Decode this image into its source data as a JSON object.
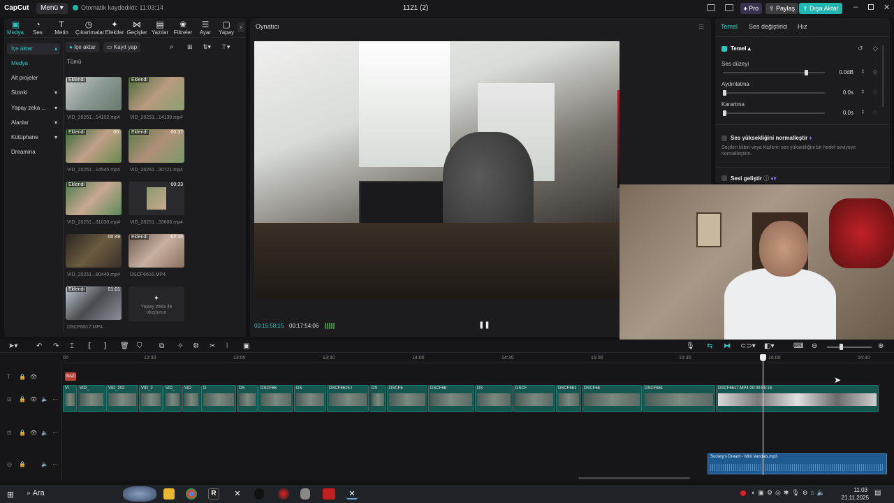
{
  "titlebar": {
    "logo": "CapCut",
    "menu": "Menü",
    "autosave": "Otomatik kaydedildi: 11:03:14",
    "project": "1121 (2)",
    "pro": "Pro",
    "share": "Paylaş",
    "upgrade": "Dışa Aktar"
  },
  "toolbar": {
    "tools": [
      {
        "label": "Medya",
        "icon": "media-icon"
      },
      {
        "label": "Ses",
        "icon": "audio-icon"
      },
      {
        "label": "Metin",
        "icon": "text-icon"
      },
      {
        "label": "Çıkartmalar",
        "icon": "sticker-icon"
      },
      {
        "label": "Efektler",
        "icon": "effects-icon"
      },
      {
        "label": "Geçişler",
        "icon": "transitions-icon"
      },
      {
        "label": "Yazılar",
        "icon": "captions-icon"
      },
      {
        "label": "Filtreler",
        "icon": "filters-icon"
      },
      {
        "label": "Ayar",
        "icon": "adjust-icon"
      },
      {
        "label": "Yapay",
        "icon": "ai-icon"
      }
    ]
  },
  "media_nav": {
    "items": [
      {
        "label": "İçe aktar"
      },
      {
        "label": "Medya"
      },
      {
        "label": "Alt projeler"
      },
      {
        "label": "Sizinki"
      },
      {
        "label": "Yapay zeka ..."
      },
      {
        "label": "Alanlar"
      },
      {
        "label": "Kütüphane"
      },
      {
        "label": "Dreamina"
      }
    ]
  },
  "media": {
    "import_btn": "İçe aktar",
    "record_btn": "Kayıt yap",
    "filter_label": "Tümü",
    "ai_create": "Yapay zeka ile oluşturun",
    "items": [
      {
        "name": "VID_20251...14102.mp4",
        "tag": "Eklendi",
        "dur": ""
      },
      {
        "name": "VID_20251...14139.mp4",
        "tag": "Eklendi",
        "dur": ""
      },
      {
        "name": "VID_20251...14545.mp4",
        "tag": "Eklendi",
        "dur": "00:"
      },
      {
        "name": "VID_20251...30721.mp4",
        "tag": "Eklendi",
        "dur": "00:37"
      },
      {
        "name": "VID_20251...31030.mp4",
        "tag": "Eklendi",
        "dur": ""
      },
      {
        "name": "VID_20251...33606.mp4",
        "tag": "",
        "dur": "00:33"
      },
      {
        "name": "VID_20251...80449.mp4",
        "tag": "",
        "dur": "00:49"
      },
      {
        "name": "DSCF6616.MP4",
        "tag": "Eklendi",
        "dur": "02:16"
      },
      {
        "name": "DSCF6617.MP4",
        "tag": "Eklendi",
        "dur": "01:01"
      }
    ]
  },
  "player": {
    "title": "Oynatıcı",
    "current_time": "00:15:58:15",
    "total_time": "00:17:54:06"
  },
  "inspector": {
    "tabs": [
      "Temel",
      "Ses değiştirici",
      "Hız"
    ],
    "section": "Temel",
    "rows": [
      {
        "label": "Ses düzeyi",
        "value": "0.0dB",
        "level": 0.8
      },
      {
        "label": "Aydınlatma",
        "value": "0.0s",
        "level": 0
      },
      {
        "label": "Karartma",
        "value": "0.0s",
        "level": 0
      }
    ],
    "normalize_label": "Ses yüksekliğini normalleştir",
    "normalize_desc": "Seçilen klibin veya kliplerin ses yüksekliğini bir hedef seviyeye normalleştirin.",
    "enhance_label": "Sesi geliştir"
  },
  "timeline": {
    "ruler": [
      "00",
      "12:30",
      "13:00",
      "13:30",
      "14:00",
      "14:30",
      "15:00",
      "15:30",
      "16:00",
      "16:30"
    ],
    "text_tag": "BAZI",
    "clips": [
      "VI",
      "VID_",
      "VID_202",
      "VID_2",
      "VID_",
      "VID",
      "D",
      "DS",
      "DSCF66",
      "DS",
      "DSCF6615.I",
      "DS",
      "DSCF6",
      "DSCF66",
      "DS",
      "DSCF",
      "DSCF661",
      "DSCF66",
      "DSCF661",
      "DSCF6617.MP4   00:00:55:16"
    ],
    "audio_clip": "Society's Dream - Mini Vandals.mp3"
  },
  "taskbar": {
    "search": "Ara",
    "time": "11:03",
    "date": "21.11.2025"
  },
  "colors": {
    "accent": "#22c8c3",
    "clip": "#15564f",
    "audio": "#1e6aa8"
  }
}
